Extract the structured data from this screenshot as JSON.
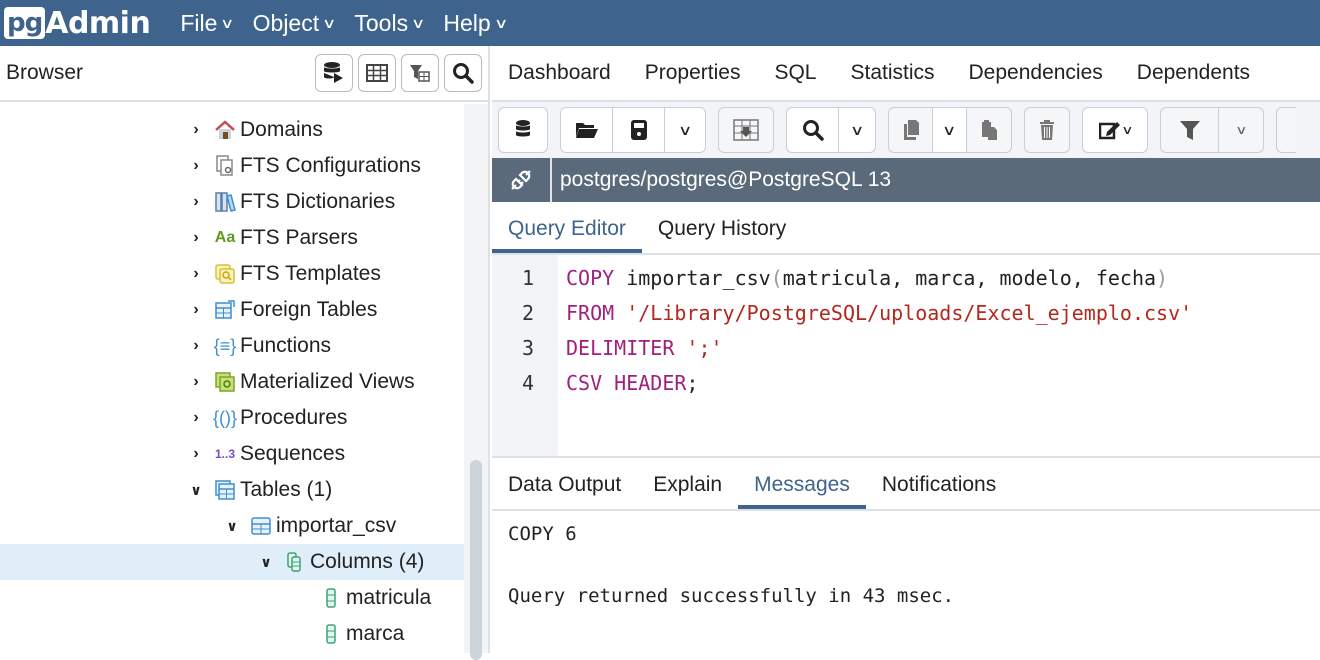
{
  "app": {
    "logo_pg": "pg",
    "logo_admin": "Admin",
    "menu": [
      {
        "label": "File"
      },
      {
        "label": "Object"
      },
      {
        "label": "Tools"
      },
      {
        "label": "Help"
      }
    ]
  },
  "browser": {
    "title": "Browser",
    "toolbar": [
      "query-tool-icon",
      "view-data-icon",
      "filtered-rows-icon",
      "search-objects-icon"
    ],
    "tree": [
      {
        "label": "Domains",
        "icon": "domains-icon",
        "expanded": false
      },
      {
        "label": "FTS Configurations",
        "icon": "fts-configurations-icon",
        "expanded": false
      },
      {
        "label": "FTS Dictionaries",
        "icon": "fts-dictionaries-icon",
        "expanded": false
      },
      {
        "label": "FTS Parsers",
        "icon": "fts-parsers-icon",
        "icon_text": "Aa",
        "expanded": false
      },
      {
        "label": "FTS Templates",
        "icon": "fts-templates-icon",
        "expanded": false
      },
      {
        "label": "Foreign Tables",
        "icon": "foreign-tables-icon",
        "expanded": false
      },
      {
        "label": "Functions",
        "icon": "functions-icon",
        "expanded": false
      },
      {
        "label": "Materialized Views",
        "icon": "materialized-views-icon",
        "expanded": false
      },
      {
        "label": "Procedures",
        "icon": "procedures-icon",
        "expanded": false
      },
      {
        "label": "Sequences",
        "icon": "sequences-icon",
        "icon_text": "1..3",
        "expanded": false
      },
      {
        "label": "Tables (1)",
        "icon": "tables-icon",
        "expanded": true
      },
      {
        "label": "importar_csv",
        "icon": "table-icon",
        "expanded": true
      },
      {
        "label": "Columns (4)",
        "icon": "columns-icon",
        "expanded": true,
        "selected": true
      },
      {
        "label": "matricula",
        "icon": "column-icon"
      },
      {
        "label": "marca",
        "icon": "column-icon"
      }
    ]
  },
  "main": {
    "tabs": [
      {
        "label": "Dashboard"
      },
      {
        "label": "Properties"
      },
      {
        "label": "SQL"
      },
      {
        "label": "Statistics"
      },
      {
        "label": "Dependencies"
      },
      {
        "label": "Dependents"
      }
    ],
    "connection": "postgres/postgres@PostgreSQL 13",
    "query_tabs": [
      {
        "label": "Query Editor",
        "active": true
      },
      {
        "label": "Query History",
        "active": false
      }
    ],
    "code_lines": [
      {
        "num": "1",
        "kw": "COPY",
        "text": " importar_csv",
        "paren_open": "(",
        "args": "matricula, marca, modelo, fecha",
        "paren_close": ")"
      },
      {
        "num": "2",
        "kw": "FROM",
        "str": "'/Library/PostgreSQL/uploads/Excel_ejemplo.csv'"
      },
      {
        "num": "3",
        "kw": "DELIMITER",
        "str": "';'"
      },
      {
        "num": "4",
        "kw": "CSV HEADER",
        "text": ";"
      }
    ],
    "output_tabs": [
      {
        "label": "Data Output",
        "active": false
      },
      {
        "label": "Explain",
        "active": false
      },
      {
        "label": "Messages",
        "active": true
      },
      {
        "label": "Notifications",
        "active": false
      }
    ],
    "messages": [
      "COPY 6",
      "Query returned successfully in 43 msec."
    ]
  },
  "colors": {
    "brand": "#3e648d",
    "connection_bar": "#5b6a7b",
    "keyword": "#a0207e",
    "string": "#b2281f",
    "selected_row": "#dfeef9"
  }
}
